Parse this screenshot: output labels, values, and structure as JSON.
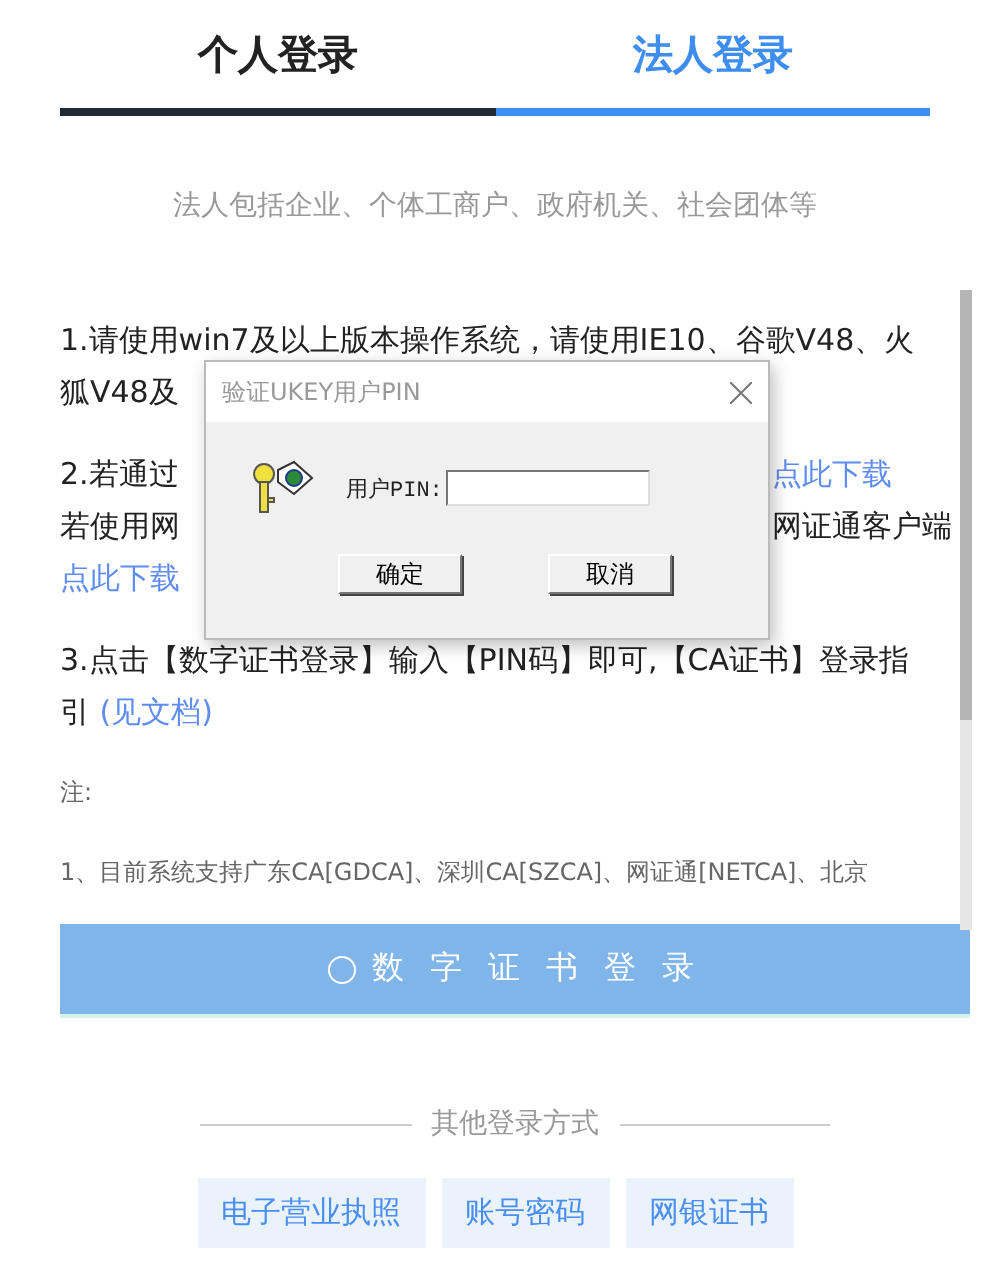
{
  "tabs": [
    {
      "label": "个人登录",
      "selected": false
    },
    {
      "label": "法人登录",
      "selected": true
    }
  ],
  "subtitle": "法人包括企业、个体工商户、政府机关、社会团体等",
  "instructions": [
    {
      "lines": [
        {
          "left": "1.请使用win7及以上版本操作系统，请使用IE10、谷歌V48、火"
        },
        {
          "left": "狐V48及"
        }
      ]
    },
    {
      "lines": [
        {
          "left": "2.若通过",
          "link": "点此下载"
        },
        {
          "left": "若使用网",
          "right": "网证通客户端"
        },
        {
          "link": "点此下载"
        }
      ]
    },
    {
      "lines": [
        {
          "left": "3.点击【数字证书登录】输入【PIN码】即可,【CA证书】登录指"
        },
        {
          "left": "引 ",
          "link": "(见文档)"
        }
      ]
    }
  ],
  "notes": [
    "注:",
    "1、目前系统支持广东CA[GDCA]、深圳CA[SZCA]、网证通[NETCA]、北京"
  ],
  "login_button": "数 字 证 书 登 录",
  "other_title": "其他登录方式",
  "other_methods": [
    "电子营业执照",
    "账号密码",
    "网银证书"
  ],
  "dialog": {
    "title": "验证UKEY用户PIN",
    "pin_label": "用户PIN:",
    "buttons": [
      "确定",
      "取消"
    ]
  }
}
